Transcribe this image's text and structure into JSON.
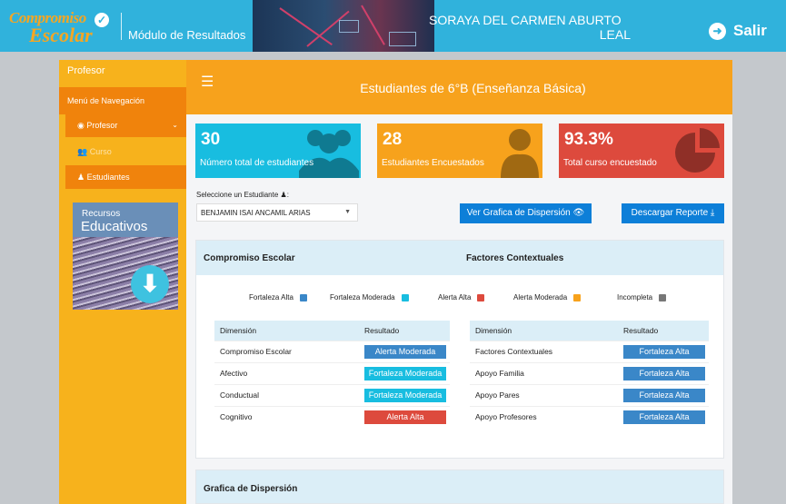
{
  "header": {
    "logo_line1": "Compromiso",
    "logo_line2": "Escolar",
    "modulo": "Módulo de Resultados",
    "user_line1": "SORAYA DEL CARMEN ABURTO",
    "user_line2": "LEAL",
    "salir_label": "Salir"
  },
  "sidebar": {
    "title": "Profesor",
    "nav_label": "Menú de Navegación",
    "items": [
      {
        "label": "Profesor",
        "icon": "user-circle-icon"
      },
      {
        "label": "Curso",
        "icon": "group-icon"
      },
      {
        "label": "Estudiantes",
        "icon": "user-icon"
      }
    ],
    "recursos_line1": "Recursos",
    "recursos_line2": "Educativos"
  },
  "main": {
    "title": "Estudiantes de 6°B (Enseñanza Básica)",
    "cards": [
      {
        "value": "30",
        "label": "Número total de estudiantes",
        "color": "#18bde0",
        "icon": "users-icon"
      },
      {
        "value": "28",
        "label": "Estudiantes Encuestados",
        "color": "#f7a21c",
        "icon": "user-icon"
      },
      {
        "value": "93.3%",
        "label": "Total curso encuestado",
        "color": "#dd4a3d",
        "icon": "pie-chart-icon"
      }
    ],
    "select_label": "Seleccione un Estudiante",
    "select_value": "BENJAMIN ISAI ANCAMIL ARIAS",
    "btn_grafica": "Ver Grafica de Dispersión",
    "btn_descargar": "Descargar Reporte",
    "panel_title_left": "Compromiso Escolar",
    "panel_title_right": "Factores Contextuales",
    "legend": [
      {
        "label": "Fortaleza Alta",
        "color": "#3a87c8"
      },
      {
        "label": "Fortaleza Moderada",
        "color": "#18bde0"
      },
      {
        "label": "Alerta Alta",
        "color": "#dd4a3d"
      },
      {
        "label": "Alerta Moderada",
        "color": "#f7a21c"
      },
      {
        "label": "Incompleta",
        "color": "#777777"
      }
    ],
    "col_dimension": "Dimensión",
    "col_resultado": "Resultado",
    "compromiso_rows": [
      {
        "dimension": "Compromiso Escolar",
        "resultado": "Alerta Moderada",
        "color": "#3a87c8"
      },
      {
        "dimension": "Afectivo",
        "resultado": "Fortaleza Moderada",
        "color": "#18bde0"
      },
      {
        "dimension": "Conductual",
        "resultado": "Fortaleza Moderada",
        "color": "#18bde0"
      },
      {
        "dimension": "Cognitivo",
        "resultado": "Alerta Alta",
        "color": "#dd4a3d"
      }
    ],
    "factores_rows": [
      {
        "dimension": "Factores Contextuales",
        "resultado": "Fortaleza Alta",
        "color": "#3a87c8"
      },
      {
        "dimension": "Apoyo Familia",
        "resultado": "Fortaleza Alta",
        "color": "#3a87c8"
      },
      {
        "dimension": "Apoyo Pares",
        "resultado": "Fortaleza Alta",
        "color": "#3a87c8"
      },
      {
        "dimension": "Apoyo Profesores",
        "resultado": "Fortaleza Alta",
        "color": "#3a87c8"
      }
    ],
    "panel2_title": "Grafica de Dispersión"
  }
}
